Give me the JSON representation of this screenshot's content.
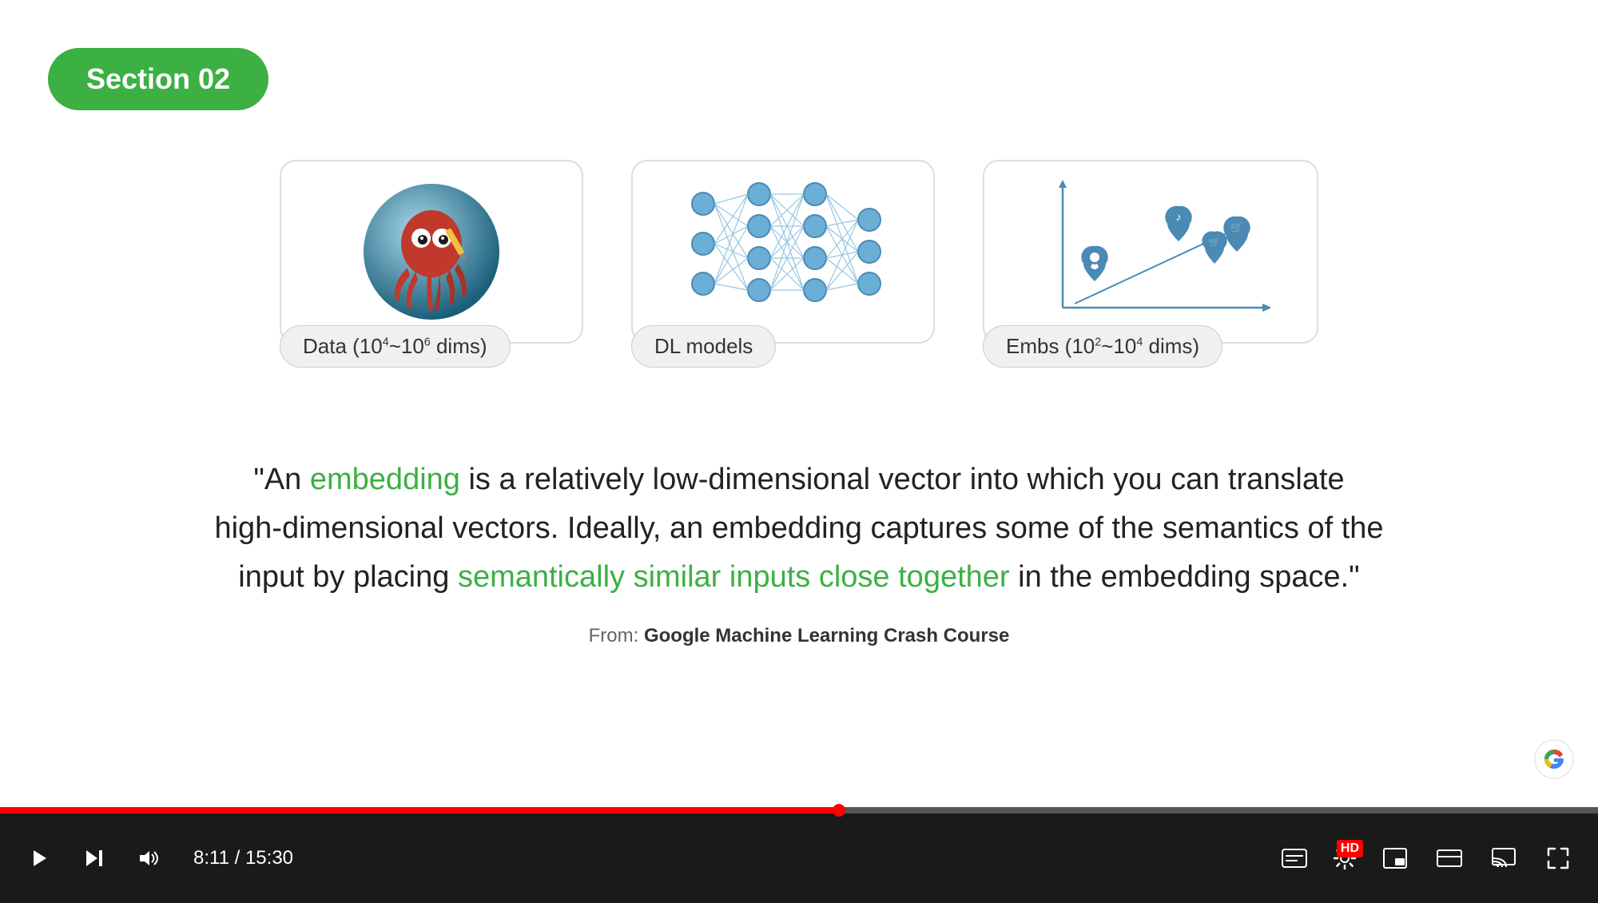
{
  "section_badge": "Section 02",
  "cards": [
    {
      "id": "data-card",
      "label": "Data (10⁴~10⁶ dims)",
      "label_parts": {
        "prefix": "Data (",
        "exp1": "4",
        "mid": "~10",
        "exp2": "6",
        "suffix": " dims)"
      },
      "type": "octopus"
    },
    {
      "id": "dl-models-card",
      "label": "DL models",
      "type": "neural_network"
    },
    {
      "id": "embs-card",
      "label": "Embs (10²~10⁴ dims)",
      "label_parts": {
        "prefix": "Embs (",
        "exp1": "2",
        "mid": "~10",
        "exp2": "4",
        "suffix": " dims)"
      },
      "type": "embedding_chart"
    }
  ],
  "quote": {
    "prefix": "\"An ",
    "embedding_word": "embedding",
    "middle1": " is a relatively low-dimensional vector into which you can translate",
    "line2": "high-dimensional vectors. Ideally, an embedding captures some of the semantics of the",
    "line3_prefix": "input by placing ",
    "similar_phrase": "semantically similar inputs close together",
    "line3_suffix": " in the embedding space.\""
  },
  "source": {
    "prefix": "From: ",
    "name": "Google Machine Learning Crash Course"
  },
  "player": {
    "current_time": "8:11",
    "total_time": "15:30",
    "progress_pct": 52.5
  },
  "controls": {
    "play": "▶",
    "skip": "⏭",
    "volume": "🔊",
    "captions": "CC",
    "settings": "⚙",
    "miniplayer": "⧉",
    "theater": "▬",
    "fullscreen": "⛶",
    "cast": "⊡"
  }
}
